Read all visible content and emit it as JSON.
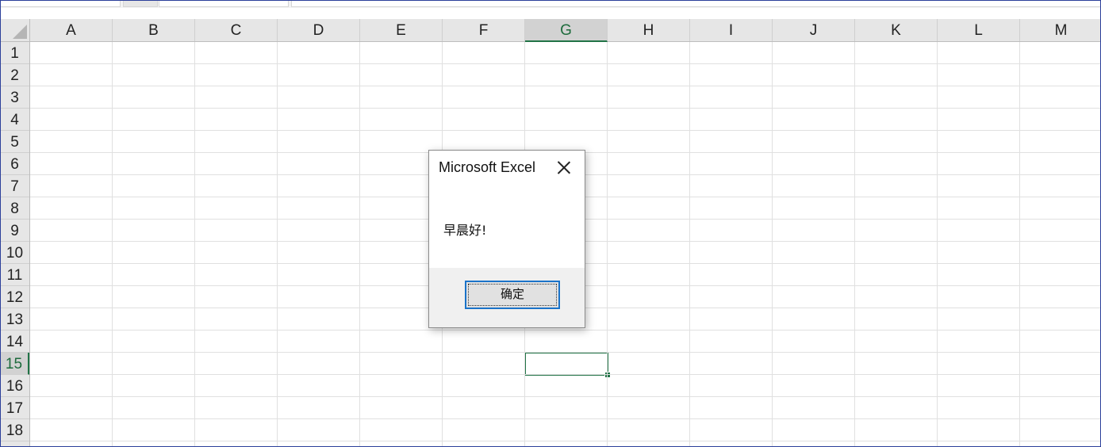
{
  "grid": {
    "columns": [
      "A",
      "B",
      "C",
      "D",
      "E",
      "F",
      "G",
      "H",
      "I",
      "J",
      "K",
      "L",
      "M"
    ],
    "rows": [
      "1",
      "2",
      "3",
      "4",
      "5",
      "6",
      "7",
      "8",
      "9",
      "10",
      "11",
      "12",
      "13",
      "14",
      "15",
      "16",
      "17",
      "18"
    ],
    "selected_column": "G",
    "selected_row": "15"
  },
  "dialog": {
    "title": "Microsoft Excel",
    "message": "早晨好!",
    "ok_label": "确定"
  },
  "colors": {
    "excel_green": "#217346",
    "header_bg": "#e6e6e6",
    "button_border": "#1a73c9"
  },
  "icons": {
    "close": "close-icon",
    "select_all": "select-all-triangle-icon"
  }
}
